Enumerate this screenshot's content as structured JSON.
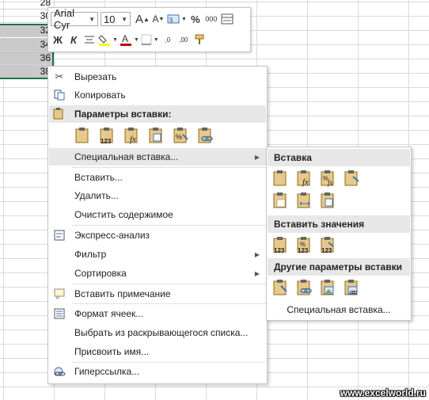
{
  "sheet": {
    "cells": [
      "28",
      "30",
      "32",
      "34",
      "36",
      "38"
    ]
  },
  "mini_toolbar": {
    "font_name": "Arial Cyr",
    "font_size": "10",
    "percent": "%",
    "thousands": "000",
    "inc_dec": ",0→,00",
    "bold": "Ж",
    "italic": "К"
  },
  "context_menu": {
    "cut": "Вырезать",
    "copy": "Копировать",
    "paste_options_header": "Параметры вставки:",
    "special_paste": "Специальная вставка...",
    "insert": "Вставить...",
    "delete": "Удалить...",
    "clear": "Очистить содержимое",
    "quick_analysis": "Экспресс-анализ",
    "filter": "Фильтр",
    "sort": "Сортировка",
    "insert_comment": "Вставить примечание",
    "format_cells": "Формат ячеек...",
    "pick_list": "Выбрать из раскрывающегося списка...",
    "define_name": "Присвоить имя...",
    "hyperlink": "Гиперссылка..."
  },
  "submenu": {
    "paste_header": "Вставка",
    "paste_values_header": "Вставить значения",
    "other_header": "Другие параметры вставки",
    "special_paste": "Специальная вставка..."
  },
  "watermark": "www.excelworld.ru",
  "icons": [
    "scissors-icon",
    "copy-icon",
    "paste-icon",
    "paste-values-icon",
    "paste-formula-icon",
    "paste-transpose-icon",
    "paste-format-icon",
    "paste-link-icon",
    "quick-analysis-icon",
    "comment-icon",
    "format-cells-icon",
    "hyperlink-icon"
  ]
}
